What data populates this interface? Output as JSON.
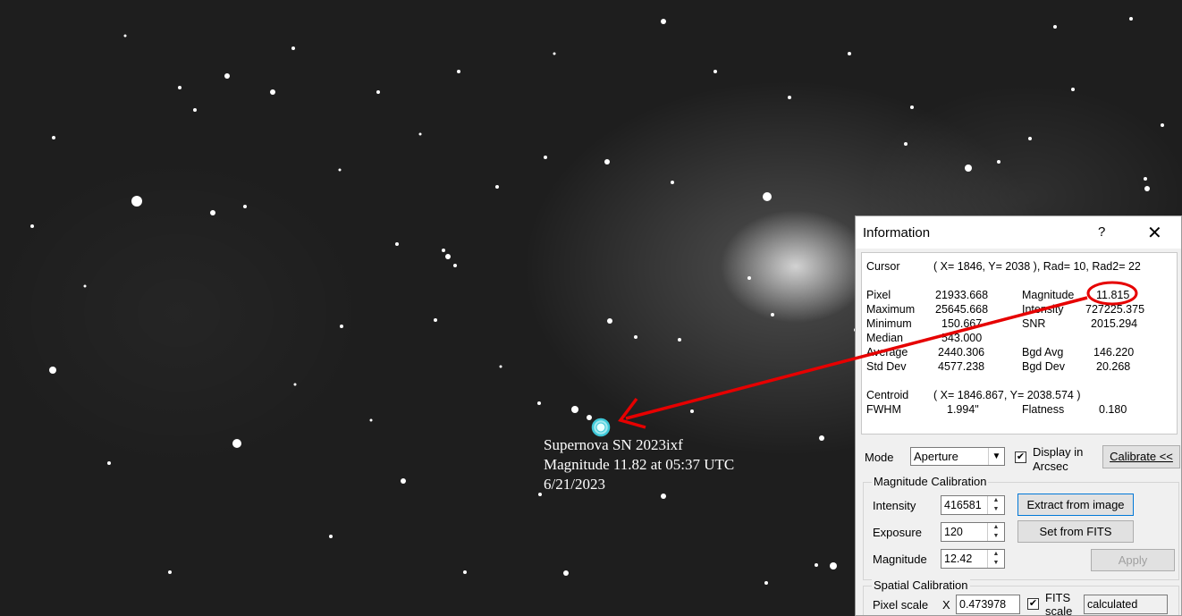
{
  "supernova": {
    "line1": "Supernova SN 2023ixf",
    "line2": "Magnitude 11.82 at 05:37 UTC",
    "line3": "6/21/2023"
  },
  "window": {
    "title": "Information",
    "help": "?",
    "close": "✕"
  },
  "readout": {
    "cursor_label": "Cursor",
    "cursor_value": "( X= 1846, Y= 2038 ), Rad= 10, Rad2= 22",
    "pixel_label": "Pixel",
    "pixel_value": "21933.668",
    "maximum_label": "Maximum",
    "maximum_value": "25645.668",
    "minimum_label": "Minimum",
    "minimum_value": "150.667",
    "median_label": "Median",
    "median_value": "543.000",
    "average_label": "Average",
    "average_value": "2440.306",
    "stddev_label": "Std Dev",
    "stddev_value": "4577.238",
    "magnitude_label": "Magnitude",
    "magnitude_value": "11.815",
    "intensity_label": "Intensity",
    "intensity_value": "727225.375",
    "snr_label": "SNR",
    "snr_value": "2015.294",
    "bgdavg_label": "Bgd Avg",
    "bgdavg_value": "146.220",
    "bgddev_label": "Bgd Dev",
    "bgddev_value": "20.268",
    "centroid_label": "Centroid",
    "centroid_value": "( X= 1846.867, Y= 2038.574 )",
    "fwhm_label": "FWHM",
    "fwhm_value": "1.994\"",
    "flatness_label": "Flatness",
    "flatness_value": "0.180"
  },
  "controls": {
    "mode_label": "Mode",
    "mode_value": "Aperture",
    "display_arcsec_line1": "Display in",
    "display_arcsec_line2": "Arcsec",
    "display_arcsec_checked": true,
    "calibrate_button": "Calibrate <<"
  },
  "magnitude_calibration": {
    "title": "Magnitude Calibration",
    "intensity_label": "Intensity",
    "intensity_value": "416581",
    "exposure_label": "Exposure",
    "exposure_value": "120",
    "magnitude_label": "Magnitude",
    "magnitude_value": "12.42",
    "extract_button": "Extract from image",
    "fits_button": "Set from FITS",
    "apply_button": "Apply"
  },
  "spatial_calibration": {
    "title": "Spatial Calibration",
    "pixel_scale_label": "Pixel scale",
    "x_label": "X",
    "x_value": "0.473978",
    "fits_scale_line1": "FITS",
    "fits_scale_line2": "scale",
    "fits_scale_checked": true,
    "calculated_value": "calculated"
  },
  "colors": {
    "annotation": "#e60000",
    "marker": "#3ec8d8",
    "default_button_border": "#0078d7"
  }
}
